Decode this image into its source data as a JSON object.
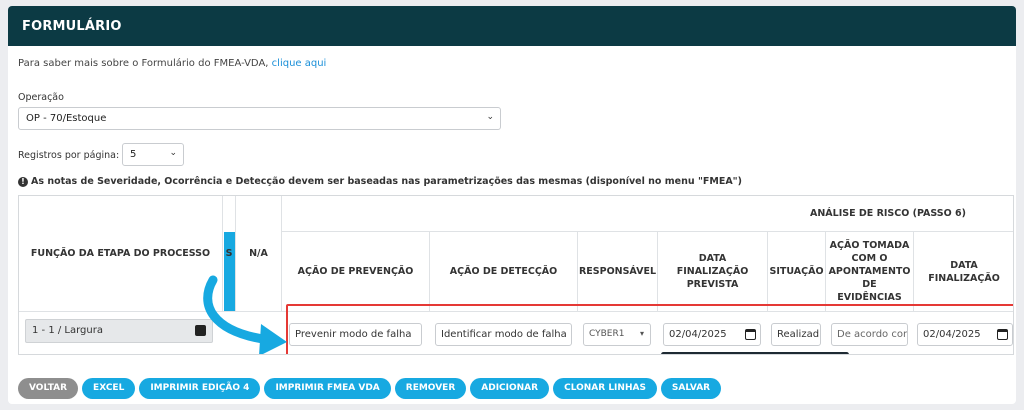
{
  "header": {
    "title": "FORMULÁRIO"
  },
  "info": {
    "text": "Para saber mais sobre o Formulário do FMEA-VDA,",
    "link": "clique aqui"
  },
  "operacao": {
    "label": "Operação",
    "value": "OP - 70/Estoque"
  },
  "registros": {
    "label": "Registros por página:",
    "value": "5"
  },
  "note": {
    "icon": "info-icon",
    "text": "As notas de Severidade, Ocorrência e Detecção devem ser baseadas nas parametrizações das mesmas (disponível no menu \"FMEA\")"
  },
  "table": {
    "col_funcao": "FUNÇÃO DA ETAPA DO PROCESSO",
    "col_s": "S",
    "col_na": "N/A",
    "group_header": "ANÁLISE DE RISCO (PASSO 6)",
    "columns": [
      "AÇÃO DE PREVENÇÃO",
      "AÇÃO DE DETECÇÃO",
      "RESPONSÁVEL",
      "DATA FINALIZAÇÃO PREVISTA",
      "SITUAÇÃO",
      "AÇÃO TOMADA COM O APONTAMENTO DE EVIDÊNCIAS",
      "DATA FINALIZAÇÃO"
    ],
    "row": {
      "funcao": "1 - 1 / Largura",
      "prevencao": "Prevenir modo de falha",
      "deteccao": "Identificar modo de falha",
      "responsavel": "CYBER1",
      "data_prevista": "02/04/2025",
      "situacao": "Realizad",
      "acao_tomada": "De acordo cor",
      "data_finalizacao": "02/04/2025"
    }
  },
  "buttons": [
    "VOLTAR",
    "EXCEL",
    "IMPRIMIR EDIÇÃO 4",
    "IMPRIMIR FMEA VDA",
    "REMOVER",
    "ADICIONAR",
    "CLONAR LINHAS",
    "SALVAR"
  ],
  "colors": {
    "header": "#0c3a44",
    "accent": "#17a9e1",
    "highlight": "#e53935"
  }
}
